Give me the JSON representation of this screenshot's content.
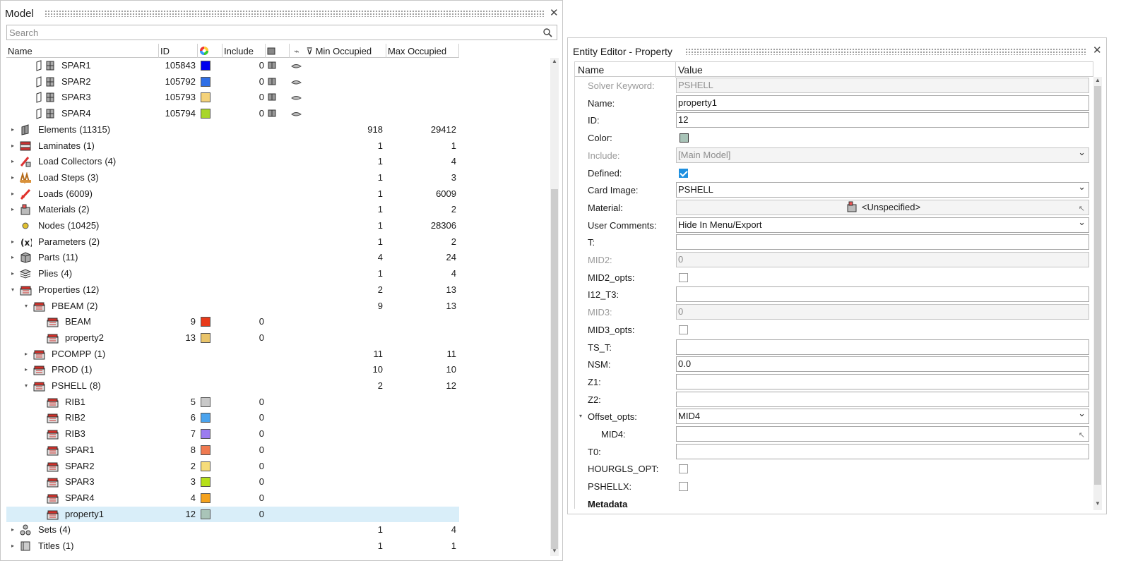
{
  "model": {
    "title": "Model",
    "search_placeholder": "Search",
    "columns": {
      "name": "Name",
      "id": "ID",
      "include": "Include",
      "min": "Min Occupied",
      "max": "Max Occupied"
    },
    "rows": [
      {
        "level": 2,
        "expand": "",
        "icon": "shell-component-icon",
        "label": "SPAR1",
        "count": "",
        "id": "105843",
        "color": "#0000ee",
        "include": "0",
        "extra": true,
        "min": "",
        "max": ""
      },
      {
        "level": 2,
        "expand": "",
        "icon": "shell-component-icon",
        "label": "SPAR2",
        "count": "",
        "id": "105792",
        "color": "#2f6fe6",
        "include": "0",
        "extra": true,
        "min": "",
        "max": ""
      },
      {
        "level": 2,
        "expand": "",
        "icon": "shell-component-icon",
        "label": "SPAR3",
        "count": "",
        "id": "105793",
        "color": "#f4d27a",
        "include": "0",
        "extra": true,
        "min": "",
        "max": ""
      },
      {
        "level": 2,
        "expand": "",
        "icon": "shell-component-icon",
        "label": "SPAR4",
        "count": "",
        "id": "105794",
        "color": "#a8d62a",
        "include": "0",
        "extra": true,
        "min": "",
        "max": ""
      },
      {
        "level": 0,
        "expand": "▸",
        "icon": "elements-icon",
        "label": "Elements",
        "count": "(11315)",
        "id": "",
        "color": "",
        "include": "",
        "extra": false,
        "min": "918",
        "max": "29412"
      },
      {
        "level": 0,
        "expand": "▸",
        "icon": "laminates-icon",
        "label": "Laminates",
        "count": "(1)",
        "id": "",
        "color": "",
        "include": "",
        "extra": false,
        "min": "1",
        "max": "1"
      },
      {
        "level": 0,
        "expand": "▸",
        "icon": "load-collectors-icon",
        "label": "Load Collectors",
        "count": "(4)",
        "id": "",
        "color": "",
        "include": "",
        "extra": false,
        "min": "1",
        "max": "4"
      },
      {
        "level": 0,
        "expand": "▸",
        "icon": "load-steps-icon",
        "label": "Load Steps",
        "count": "(3)",
        "id": "",
        "color": "",
        "include": "",
        "extra": false,
        "min": "1",
        "max": "3"
      },
      {
        "level": 0,
        "expand": "▸",
        "icon": "loads-icon",
        "label": "Loads",
        "count": "(6009)",
        "id": "",
        "color": "",
        "include": "",
        "extra": false,
        "min": "1",
        "max": "6009"
      },
      {
        "level": 0,
        "expand": "▸",
        "icon": "materials-icon",
        "label": "Materials",
        "count": "(2)",
        "id": "",
        "color": "",
        "include": "",
        "extra": false,
        "min": "1",
        "max": "2"
      },
      {
        "level": 0,
        "expand": "",
        "icon": "nodes-icon",
        "label": "Nodes",
        "count": "(10425)",
        "id": "",
        "color": "",
        "include": "",
        "extra": false,
        "min": "1",
        "max": "28306"
      },
      {
        "level": 0,
        "expand": "▸",
        "icon": "parameters-icon",
        "label": "Parameters",
        "count": "(2)",
        "id": "",
        "color": "",
        "include": "",
        "extra": false,
        "min": "1",
        "max": "2"
      },
      {
        "level": 0,
        "expand": "▸",
        "icon": "parts-icon",
        "label": "Parts",
        "count": "(11)",
        "id": "",
        "color": "",
        "include": "",
        "extra": false,
        "min": "4",
        "max": "24"
      },
      {
        "level": 0,
        "expand": "▸",
        "icon": "plies-icon",
        "label": "Plies",
        "count": "(4)",
        "id": "",
        "color": "",
        "include": "",
        "extra": false,
        "min": "1",
        "max": "4"
      },
      {
        "level": 0,
        "expand": "▾",
        "icon": "properties-icon",
        "label": "Properties",
        "count": "(12)",
        "id": "",
        "color": "",
        "include": "",
        "extra": false,
        "min": "2",
        "max": "13"
      },
      {
        "level": 1,
        "expand": "▾",
        "icon": "property-icon",
        "label": "PBEAM",
        "count": "(2)",
        "id": "",
        "color": "",
        "include": "",
        "extra": false,
        "min": "9",
        "max": "13"
      },
      {
        "level": 2,
        "expand": "",
        "icon": "property-icon",
        "label": "BEAM",
        "count": "",
        "id": "9",
        "color": "#e83a1a",
        "include": "0",
        "extra": false,
        "min": "",
        "max": ""
      },
      {
        "level": 2,
        "expand": "",
        "icon": "property-icon",
        "label": "property2",
        "count": "",
        "id": "13",
        "color": "#e9c46a",
        "include": "0",
        "extra": false,
        "min": "",
        "max": ""
      },
      {
        "level": 1,
        "expand": "▸",
        "icon": "property-icon",
        "label": "PCOMPP",
        "count": "(1)",
        "id": "",
        "color": "",
        "include": "",
        "extra": false,
        "min": "11",
        "max": "11"
      },
      {
        "level": 1,
        "expand": "▸",
        "icon": "property-icon",
        "label": "PROD",
        "count": "(1)",
        "id": "",
        "color": "",
        "include": "",
        "extra": false,
        "min": "10",
        "max": "10"
      },
      {
        "level": 1,
        "expand": "▾",
        "icon": "property-icon",
        "label": "PSHELL",
        "count": "(8)",
        "id": "",
        "color": "",
        "include": "",
        "extra": false,
        "min": "2",
        "max": "12"
      },
      {
        "level": 2,
        "expand": "",
        "icon": "property-icon",
        "label": "RIB1",
        "count": "",
        "id": "5",
        "color": "#c8c8c8",
        "include": "0",
        "extra": false,
        "min": "",
        "max": ""
      },
      {
        "level": 2,
        "expand": "",
        "icon": "property-icon",
        "label": "RIB2",
        "count": "",
        "id": "6",
        "color": "#4aa3ee",
        "include": "0",
        "extra": false,
        "min": "",
        "max": ""
      },
      {
        "level": 2,
        "expand": "",
        "icon": "property-icon",
        "label": "RIB3",
        "count": "",
        "id": "7",
        "color": "#9b7cf0",
        "include": "0",
        "extra": false,
        "min": "",
        "max": ""
      },
      {
        "level": 2,
        "expand": "",
        "icon": "property-icon",
        "label": "SPAR1",
        "count": "",
        "id": "8",
        "color": "#f07a50",
        "include": "0",
        "extra": false,
        "min": "",
        "max": ""
      },
      {
        "level": 2,
        "expand": "",
        "icon": "property-icon",
        "label": "SPAR2",
        "count": "",
        "id": "2",
        "color": "#f6dc7a",
        "include": "0",
        "extra": false,
        "min": "",
        "max": ""
      },
      {
        "level": 2,
        "expand": "",
        "icon": "property-icon",
        "label": "SPAR3",
        "count": "",
        "id": "3",
        "color": "#b6e01a",
        "include": "0",
        "extra": false,
        "min": "",
        "max": ""
      },
      {
        "level": 2,
        "expand": "",
        "icon": "property-icon",
        "label": "SPAR4",
        "count": "",
        "id": "4",
        "color": "#f4a21e",
        "include": "0",
        "extra": false,
        "min": "",
        "max": ""
      },
      {
        "level": 2,
        "expand": "",
        "icon": "property-icon",
        "label": "property1",
        "count": "",
        "id": "12",
        "color": "#a9c4b8",
        "include": "0",
        "extra": false,
        "min": "",
        "max": "",
        "selected": true
      },
      {
        "level": 0,
        "expand": "▸",
        "icon": "sets-icon",
        "label": "Sets",
        "count": "(4)",
        "id": "",
        "color": "",
        "include": "",
        "extra": false,
        "min": "1",
        "max": "4"
      },
      {
        "level": 0,
        "expand": "▸",
        "icon": "titles-icon",
        "label": "Titles",
        "count": "(1)",
        "id": "",
        "color": "",
        "include": "",
        "extra": false,
        "min": "1",
        "max": "1"
      }
    ]
  },
  "editor": {
    "title": "Entity Editor - Property",
    "col_name": "Name",
    "col_value": "Value",
    "rows": [
      {
        "name": "Solver Keyword:",
        "type": "text",
        "value": "PSHELL",
        "disabled": true
      },
      {
        "name": "Name:",
        "type": "text",
        "value": "property1"
      },
      {
        "name": "ID:",
        "type": "text",
        "value": "12"
      },
      {
        "name": "Color:",
        "type": "color",
        "value": "#a9c4b8"
      },
      {
        "name": "Include:",
        "type": "select",
        "value": "[Main Model]",
        "disabled": true
      },
      {
        "name": "Defined:",
        "type": "check",
        "checked": true
      },
      {
        "name": "Card Image:",
        "type": "select",
        "value": "PSHELL"
      },
      {
        "name": "Material:",
        "type": "material",
        "value": "<Unspecified>"
      },
      {
        "name": "User Comments:",
        "type": "select",
        "value": "Hide In Menu/Export"
      },
      {
        "name": "T:",
        "type": "text",
        "value": ""
      },
      {
        "name": "MID2:",
        "type": "text",
        "value": "0",
        "disabled": true
      },
      {
        "name": "MID2_opts:",
        "type": "check",
        "checked": false
      },
      {
        "name": "I12_T3:",
        "type": "text",
        "value": ""
      },
      {
        "name": "MID3:",
        "type": "text",
        "value": "0",
        "disabled": true
      },
      {
        "name": "MID3_opts:",
        "type": "check",
        "checked": false
      },
      {
        "name": "TS_T:",
        "type": "text",
        "value": ""
      },
      {
        "name": "NSM:",
        "type": "text",
        "value": "0.0"
      },
      {
        "name": "Z1:",
        "type": "text",
        "value": ""
      },
      {
        "name": "Z2:",
        "type": "text",
        "value": ""
      },
      {
        "name": "Offset_opts:",
        "type": "select",
        "value": "MID4",
        "expander": "▾"
      },
      {
        "name": "MID4:",
        "type": "entity",
        "value": "",
        "indent": true
      },
      {
        "name": "T0:",
        "type": "text",
        "value": ""
      },
      {
        "name": "HOURGLS_OPT:",
        "type": "check",
        "checked": false
      },
      {
        "name": "PSHELLX:",
        "type": "check",
        "checked": false
      },
      {
        "name": "Metadata",
        "type": "section"
      }
    ]
  }
}
